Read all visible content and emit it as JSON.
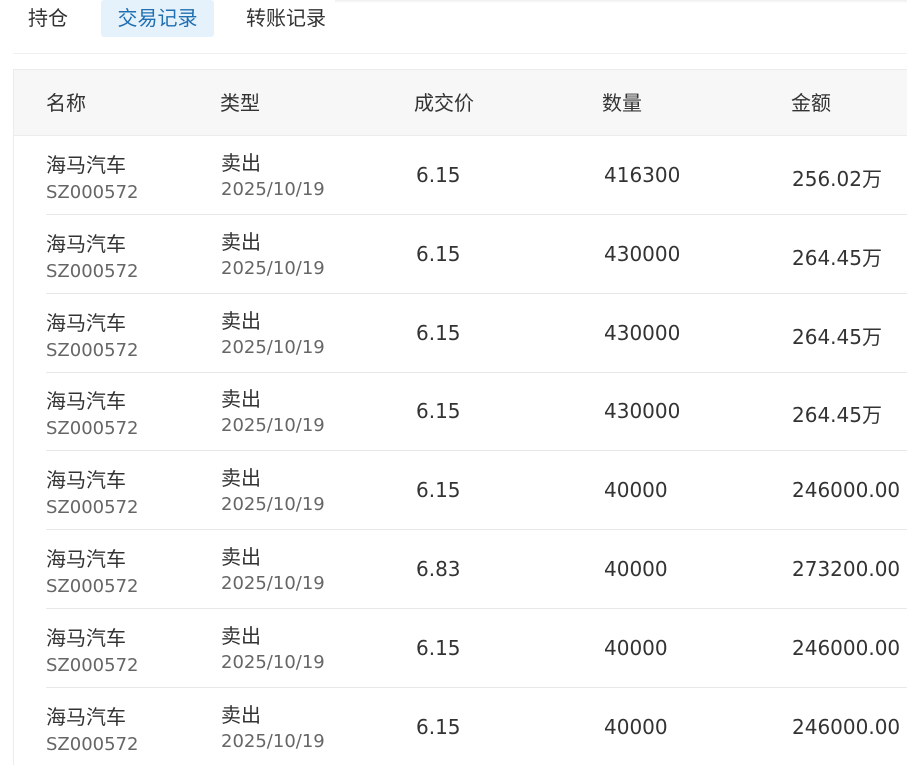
{
  "tabs": [
    {
      "label": "持仓",
      "active": false
    },
    {
      "label": "交易记录",
      "active": true
    },
    {
      "label": "转账记录",
      "active": false
    }
  ],
  "colors": {
    "active_tab_bg": "#e6f2fb",
    "active_tab_text": "#1f6fb2",
    "header_bg": "#f7f7f7"
  },
  "table": {
    "columns": [
      "名称",
      "类型",
      "成交价",
      "数量",
      "金额"
    ],
    "rows": [
      {
        "name": "海马汽车",
        "code": "SZ000572",
        "type": "卖出",
        "date": "2025/10/19",
        "price": "6.15",
        "qty": "416300",
        "amount": "256.02万"
      },
      {
        "name": "海马汽车",
        "code": "SZ000572",
        "type": "卖出",
        "date": "2025/10/19",
        "price": "6.15",
        "qty": "430000",
        "amount": "264.45万"
      },
      {
        "name": "海马汽车",
        "code": "SZ000572",
        "type": "卖出",
        "date": "2025/10/19",
        "price": "6.15",
        "qty": "430000",
        "amount": "264.45万"
      },
      {
        "name": "海马汽车",
        "code": "SZ000572",
        "type": "卖出",
        "date": "2025/10/19",
        "price": "6.15",
        "qty": "430000",
        "amount": "264.45万"
      },
      {
        "name": "海马汽车",
        "code": "SZ000572",
        "type": "卖出",
        "date": "2025/10/19",
        "price": "6.15",
        "qty": "40000",
        "amount": "246000.00"
      },
      {
        "name": "海马汽车",
        "code": "SZ000572",
        "type": "卖出",
        "date": "2025/10/19",
        "price": "6.83",
        "qty": "40000",
        "amount": "273200.00"
      },
      {
        "name": "海马汽车",
        "code": "SZ000572",
        "type": "卖出",
        "date": "2025/10/19",
        "price": "6.15",
        "qty": "40000",
        "amount": "246000.00"
      },
      {
        "name": "海马汽车",
        "code": "SZ000572",
        "type": "卖出",
        "date": "2025/10/19",
        "price": "6.15",
        "qty": "40000",
        "amount": "246000.00"
      }
    ]
  }
}
